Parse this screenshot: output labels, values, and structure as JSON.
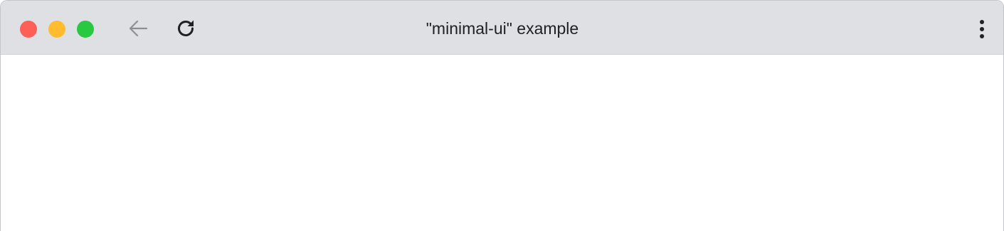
{
  "window": {
    "title": "\"minimal-ui\" example"
  },
  "traffic_lights": {
    "close_color": "#fe5f57",
    "minimize_color": "#febc2e",
    "zoom_color": "#28c840"
  },
  "toolbar": {
    "back_icon": "arrow-left-icon",
    "back_enabled": false,
    "reload_icon": "reload-icon",
    "menu_icon": "more-vertical-icon"
  },
  "colors": {
    "titlebar_bg": "#dfe0e4",
    "content_bg": "#ffffff",
    "icon_active": "#202124",
    "icon_disabled": "#8e8f93"
  }
}
